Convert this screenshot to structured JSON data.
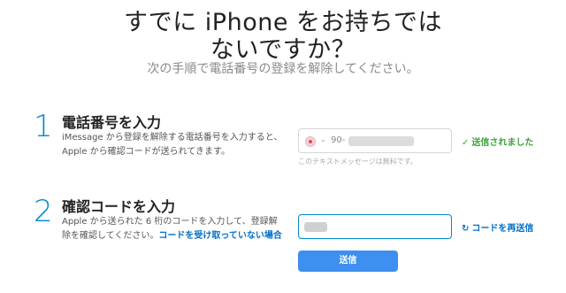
{
  "header": {
    "title_line1": "すでに iPhone をお持ちでは",
    "title_line2": "ないですか？",
    "subtitle": "次の手順で電話番号の登録を解除してください。"
  },
  "step1": {
    "number": "1",
    "heading": "電話番号を入力",
    "desc_line1": "iMessage から登録を解除する電話番号を入力すると、",
    "desc_line2": "Apple から確認コードが送られてきます。",
    "phone_prefix": "90-",
    "chevron": "⌄",
    "field_note": "このテキストメッセージは無料です。",
    "status_icon": "✓",
    "status": "送信されました",
    "status_color": "#3aa33a"
  },
  "step2": {
    "number": "2",
    "heading": "確認コードを入力",
    "desc_line1": "Apple から送られた 6 桁のコードを入力して、登録解",
    "desc_line2": "除を確認してください。",
    "link": "コードを受け取っていない場合",
    "resend_icon": "↻",
    "resend": "コードを再送信",
    "submit": "送信",
    "accent_color": "#0088cc"
  }
}
